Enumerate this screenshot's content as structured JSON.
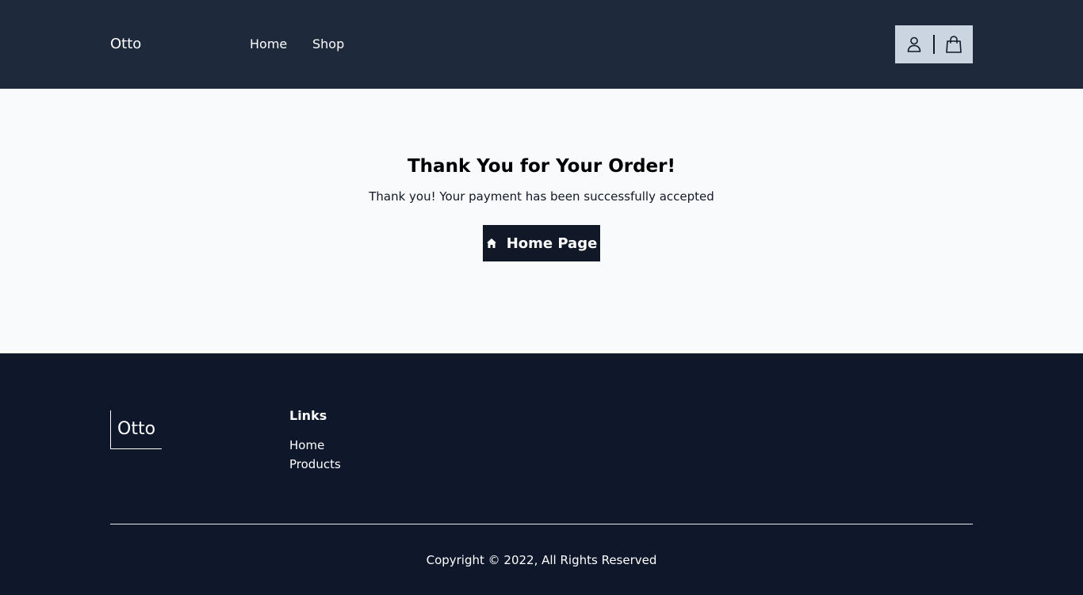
{
  "header": {
    "brand": "Otto",
    "nav": [
      {
        "label": "Home"
      },
      {
        "label": "Shop"
      }
    ],
    "icons": {
      "account": "user-icon",
      "cart": "shopping-bag-icon"
    }
  },
  "main": {
    "title": "Thank You for Your Order!",
    "message": "Thank you! Your payment has been successfully accepted",
    "button": {
      "label": "Home Page",
      "icon": "home-icon"
    }
  },
  "footer": {
    "logo": "Otto",
    "links_heading": "Links",
    "links": [
      {
        "label": "Home"
      },
      {
        "label": "Products"
      }
    ],
    "copyright": "Copyright © 2022, All Rights Reserved"
  },
  "colors": {
    "navbar_bg": "#1e293b",
    "main_bg": "#f8fafc",
    "footer_bg": "#0f172a",
    "icon_box_bg": "#cbd5e1",
    "button_bg": "#111827"
  }
}
